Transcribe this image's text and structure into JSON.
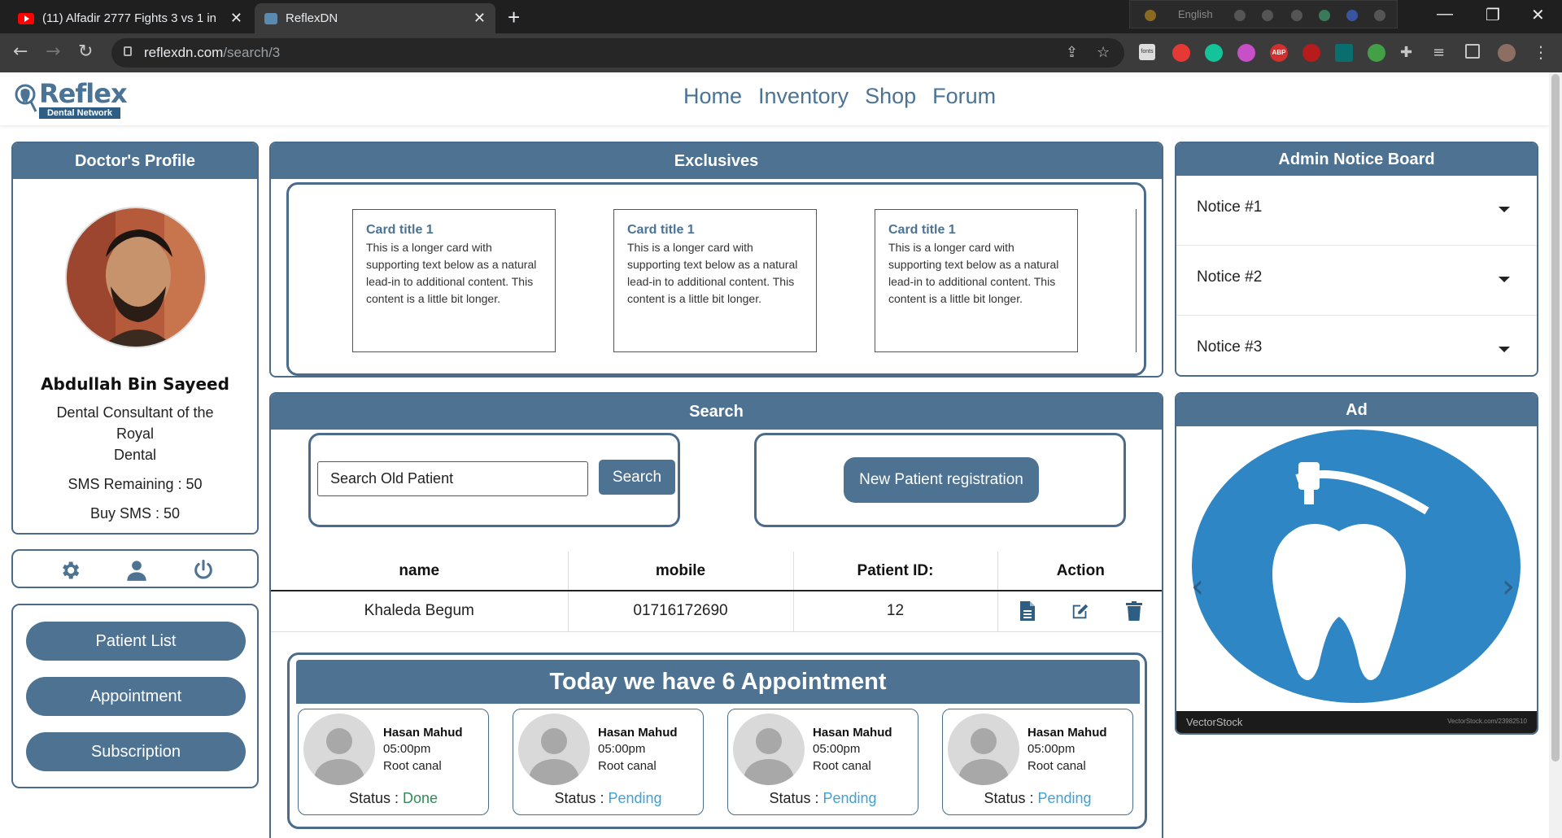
{
  "browser": {
    "tabs": [
      {
        "title": "(11) Alfadir 2777 Fights 3 vs 1 in",
        "favicon": "youtube-icon",
        "active": false
      },
      {
        "title": "ReflexDN",
        "favicon": "reflex-icon",
        "active": true
      }
    ],
    "url_host": "reflexdn.com",
    "url_path": "/search/3",
    "lang_label": "English",
    "ext_fonts_label": "fonts",
    "ext_abp_label": "ABP"
  },
  "site": {
    "logo_word": "Reflex",
    "logo_sub": "Dental Network",
    "nav": [
      "Home",
      "Inventory",
      "Shop",
      "Forum"
    ]
  },
  "profile": {
    "header": "Doctor's Profile",
    "name": "Abdullah Bin Sayeed",
    "title_line1": "Dental Consultant of the",
    "title_line2": "Royal",
    "title_line3": "Dental",
    "sms_remaining": "SMS Remaining : 50",
    "buy_sms": "Buy SMS : 50"
  },
  "left_nav": [
    "Patient List",
    "Appointment",
    "Subscription"
  ],
  "exclusives": {
    "header": "Exclusives",
    "cards": [
      {
        "title": "Card title 1",
        "body": "This is a longer card with supporting text below as a natural lead-in to additional content. This content is a little bit longer."
      },
      {
        "title": "Card title 1",
        "body": "This is a longer card with supporting text below as a natural lead-in to additional content. This content is a little bit longer."
      },
      {
        "title": "Card title 1",
        "body": "This is a longer card with supporting text below as a natural lead-in to additional content. This content is a little bit longer."
      }
    ]
  },
  "search": {
    "header": "Search",
    "input_value": "Search Old Patient",
    "search_label": "Search",
    "register_label": "New Patient registration"
  },
  "table": {
    "headers": [
      "name",
      "mobile",
      "Patient ID:",
      "Action"
    ],
    "rows": [
      {
        "name": "Khaleda Begum",
        "mobile": "01716172690",
        "id": "12"
      }
    ]
  },
  "appointments": {
    "heading": "Today we have 6 Appointment",
    "status_prefix": "Status : ",
    "items": [
      {
        "name": "Hasan Mahud",
        "time": "05:00pm",
        "procedure": "Root canal",
        "status": "Done"
      },
      {
        "name": "Hasan Mahud",
        "time": "05:00pm",
        "procedure": "Root canal",
        "status": "Pending"
      },
      {
        "name": "Hasan Mahud",
        "time": "05:00pm",
        "procedure": "Root canal",
        "status": "Pending"
      },
      {
        "name": "Hasan Mahud",
        "time": "05:00pm",
        "procedure": "Root canal",
        "status": "Pending"
      }
    ]
  },
  "notice_board": {
    "header": "Admin Notice Board",
    "items": [
      "Notice #1",
      "Notice #2",
      "Notice #3"
    ]
  },
  "ad": {
    "header": "Ad",
    "brand": "VectorStock",
    "brand_url": "VectorStock.com/23982510"
  },
  "colors": {
    "primary": "#4e7392",
    "done": "#2e8b57",
    "pending": "#3aa3d8",
    "ad_blue": "#2f86c5"
  }
}
